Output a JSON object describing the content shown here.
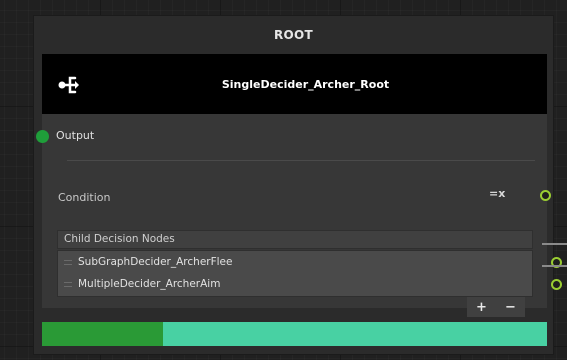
{
  "node": {
    "title": "ROOT",
    "name": "SingleDecider_Archer_Root",
    "icon": "branch-decider-icon",
    "output_label": "Output",
    "condition_label": "Condition",
    "condition_icon": "=x",
    "list": {
      "header": "Child Decision Nodes",
      "items": [
        {
          "label": "SubGraphDecider_ArcherFlee"
        },
        {
          "label": "MultipleDecider_ArcherAim"
        }
      ],
      "add_label": "+",
      "remove_label": "−"
    },
    "progress_fraction": 0.24,
    "colors": {
      "header_bg": "#000000",
      "output_port": "#1f9e3a",
      "port_ring": "#9acd32",
      "progress_track": "#48d1a3",
      "progress_fill": "#2a9a36"
    }
  }
}
